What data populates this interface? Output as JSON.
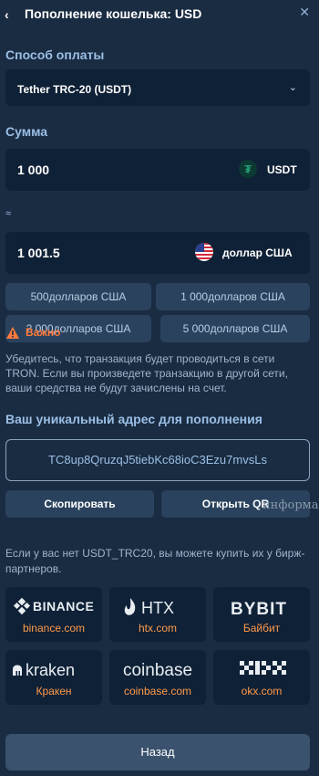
{
  "header": {
    "title": "Пополнение кошелька: USD",
    "back_icon": "chevron-left-icon",
    "close_icon": "close-icon"
  },
  "payment": {
    "label": "Способ оплаты",
    "selected": "Tether TRC-20 (USDT)"
  },
  "amount": {
    "label": "Сумма",
    "value": "1 000",
    "currency": "USDT",
    "approx_symbol": "≈",
    "converted_value": "1 001.5",
    "converted_currency": "доллар США"
  },
  "quick_amounts": [
    "500долларов США",
    "1 000долларов США",
    "2 000долларов США",
    "5 000долларов США"
  ],
  "warning": {
    "label": "Важно",
    "text": "Убедитесь, что транзакция будет проводиться в сети TRON. Если вы произведете транзакцию в другой сети, ваши средства не будут зачислены на счет."
  },
  "address": {
    "title": "Ваш уникальный адрес для пополнения",
    "value": "TC8up8QruzqJ5tiebKc68ioC3Ezu7mvsLs",
    "copy_label": "Скопировать",
    "qr_label": "Открыть QR",
    "overlay_text": "информа"
  },
  "partners": {
    "note": "Если у вас нет USDT_TRC20, вы можете купить их у бирж-партнеров.",
    "items": [
      {
        "logo": "BINANCE",
        "label": "binance.com"
      },
      {
        "logo": "HTX",
        "label": "htx.com"
      },
      {
        "logo": "BYBIT",
        "label": "Байбит"
      },
      {
        "logo": "kraken",
        "label": "Кракен"
      },
      {
        "logo": "coinbase",
        "label": "coinbase.com"
      },
      {
        "logo": "OKX",
        "label": "okx.com"
      }
    ]
  },
  "footer": {
    "back_label": "Назад"
  },
  "colors": {
    "background": "#1a2c42",
    "field": "#0f2136",
    "accent_label": "#9bbfe5",
    "warning": "#ff7a3c",
    "exchange_link": "#ff9a4a"
  }
}
